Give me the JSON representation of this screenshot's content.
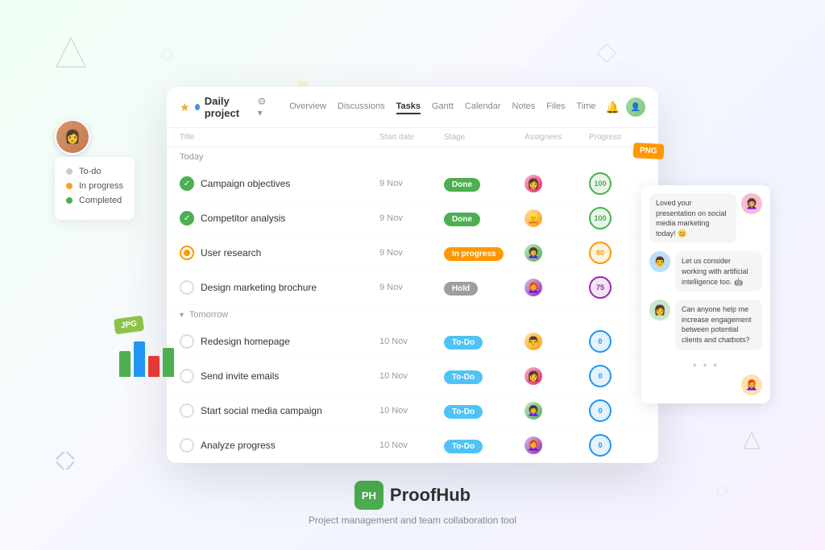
{
  "app": {
    "title": "ProofHub",
    "tagline": "Project management and team collaboration tool",
    "logo_text": "PH"
  },
  "project": {
    "name": "Daily project",
    "tabs": [
      "Overview",
      "Discussions",
      "Tasks",
      "Gantt",
      "Calendar",
      "Notes",
      "Files",
      "Time"
    ],
    "active_tab": "Tasks"
  },
  "table": {
    "columns": [
      "Title",
      "Start date",
      "Stage",
      "Assignees",
      "Progress"
    ]
  },
  "sections": {
    "today": {
      "label": "Today",
      "tasks": [
        {
          "id": 1,
          "name": "Campaign objectives",
          "date": "9 Nov",
          "stage": "Done",
          "stage_type": "done",
          "progress": 100,
          "progress_type": "100"
        },
        {
          "id": 2,
          "name": "Competitor analysis",
          "date": "9 Nov",
          "stage": "Done",
          "stage_type": "done",
          "progress": 100,
          "progress_type": "100"
        },
        {
          "id": 3,
          "name": "User research",
          "date": "9 Nov",
          "stage": "In progress",
          "stage_type": "in-progress",
          "progress": 80,
          "progress_type": "80"
        },
        {
          "id": 4,
          "name": "Design marketing brochure",
          "date": "9 Nov",
          "stage": "Hold",
          "stage_type": "hold",
          "progress": 75,
          "progress_type": "75"
        }
      ]
    },
    "tomorrow": {
      "label": "Tomorrow",
      "tasks": [
        {
          "id": 5,
          "name": "Redesign homepage",
          "date": "10 Nov",
          "stage": "To-Do",
          "stage_type": "todo",
          "progress": 0,
          "progress_type": "0"
        },
        {
          "id": 6,
          "name": "Send invite emails",
          "date": "10 Nov",
          "stage": "To-Do",
          "stage_type": "todo",
          "progress": 0,
          "progress_type": "0"
        },
        {
          "id": 7,
          "name": "Start social media campaign",
          "date": "10 Nov",
          "stage": "To-Do",
          "stage_type": "todo",
          "progress": 0,
          "progress_type": "0"
        },
        {
          "id": 8,
          "name": "Analyze progress",
          "date": "10 Nov",
          "stage": "To-Do",
          "stage_type": "todo",
          "progress": 0,
          "progress_type": "0"
        }
      ]
    }
  },
  "legend": {
    "items": [
      {
        "label": "To-do",
        "color": "gray"
      },
      {
        "label": "In progress",
        "color": "yellow"
      },
      {
        "label": "Completed",
        "color": "green"
      }
    ]
  },
  "chat": {
    "messages": [
      {
        "text": "Loved your presentation on social media marketing today! 😊"
      },
      {
        "text": "Let us consider working with artificial intelligence too. 🤖"
      },
      {
        "text": "Can anyone help me increase engagement between potential clients and chatbots?"
      }
    ]
  },
  "stickers": {
    "png": "PNG",
    "jpg": "JPG"
  },
  "avatars": {
    "user": "👩",
    "chat1": "👩‍🦰",
    "chat2": "👨",
    "chat3": "👩‍🦱"
  }
}
